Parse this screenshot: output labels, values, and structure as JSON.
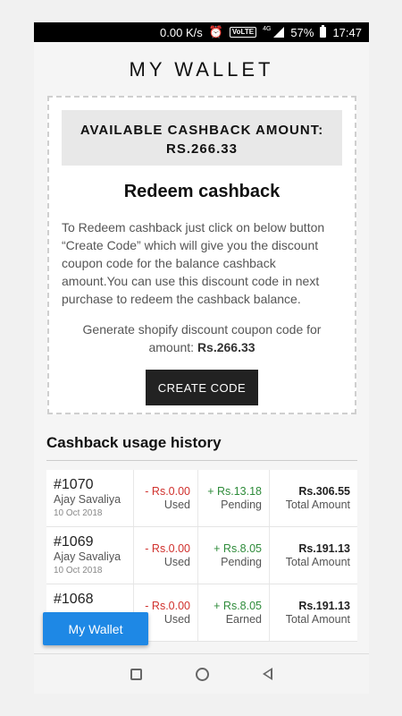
{
  "status_bar": {
    "net_speed": "0.00 K/s",
    "alarm_icon": "alarm-icon",
    "volte": "VoLTE",
    "network": "4G",
    "battery": "57%",
    "time": "17:47"
  },
  "page": {
    "title": "MY WALLET"
  },
  "cashback": {
    "available_label": "AVAILABLE CASHBACK AMOUNT:",
    "available_value": "RS.266.33",
    "redeem_title": "Redeem cashback",
    "description": "To Redeem cashback just click on below button “Create Code” which will give you the discount coupon code for the balance cashback amount.You can use this discount code in next purchase to redeem the cashback balance.",
    "generate_text": "Generate shopify discount coupon code for amount:",
    "generate_amount": "Rs.266.33",
    "create_code_label": "CREATE CODE"
  },
  "history": {
    "title": "Cashback usage history",
    "rows": [
      {
        "order": "#1070",
        "customer": "Ajay Savaliya",
        "date": "10 Oct 2018",
        "used_amount": "- Rs.0.00",
        "used_label": "Used",
        "earned_amount": "+ Rs.13.18",
        "status": "Pending",
        "total": "Rs.306.55",
        "total_label": "Total Amount"
      },
      {
        "order": "#1069",
        "customer": "Ajay Savaliya",
        "date": "10 Oct 2018",
        "used_amount": "- Rs.0.00",
        "used_label": "Used",
        "earned_amount": "+ Rs.8.05",
        "status": "Pending",
        "total": "Rs.191.13",
        "total_label": "Total Amount"
      },
      {
        "order": "#1068",
        "customer": "",
        "date": "",
        "used_amount": "- Rs.0.00",
        "used_label": "Used",
        "earned_amount": "+ Rs.8.05",
        "status": "Earned",
        "total": "Rs.191.13",
        "total_label": "Total Amount"
      }
    ]
  },
  "floating_button": {
    "label": "My Wallet"
  },
  "nav": {
    "recent": "recent-apps-icon",
    "home": "home-icon",
    "back": "back-icon"
  },
  "colors": {
    "accent": "#1e88e5",
    "negative": "#d0312d",
    "positive": "#2e8b3a",
    "button_dark": "#222222"
  }
}
